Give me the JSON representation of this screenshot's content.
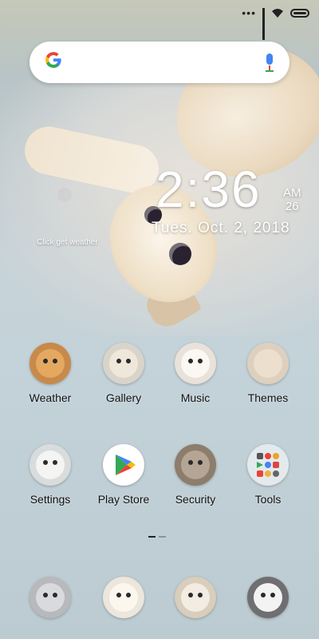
{
  "status_bar": {
    "icons": [
      "dots-icon",
      "signal-icon",
      "wifi-icon",
      "battery-icon"
    ],
    "dots": "•••"
  },
  "search": {
    "logo": "G",
    "mic_icon": "mic-icon"
  },
  "clock": {
    "time": "2:36",
    "ampm": "AM",
    "day_number": "26",
    "date": "Tues.  Oct. 2,  2018"
  },
  "weather": {
    "link": "Click get weather"
  },
  "apps": [
    {
      "label": "Weather",
      "icon": "weather-cat-icon"
    },
    {
      "label": "Gallery",
      "icon": "gallery-cat-icon"
    },
    {
      "label": "Music",
      "icon": "music-cat-icon"
    },
    {
      "label": "Themes",
      "icon": "themes-cat-icon"
    },
    {
      "label": "Settings",
      "icon": "settings-cat-icon"
    },
    {
      "label": "Play Store",
      "icon": "play-store-icon"
    },
    {
      "label": "Security",
      "icon": "security-cat-icon"
    },
    {
      "label": "Tools",
      "icon": "tools-folder-icon"
    }
  ],
  "dock": [
    {
      "icon": "dock-app-1-cat-icon"
    },
    {
      "icon": "dock-app-2-cat-icon"
    },
    {
      "icon": "dock-app-3-cat-icon"
    },
    {
      "icon": "dock-app-4-cat-icon"
    }
  ],
  "pager": {
    "pages": 2,
    "current": 1
  },
  "colors": {
    "google_blue": "#4285F4",
    "google_red": "#EA4335",
    "google_yellow": "#FBBC05",
    "google_green": "#34A853"
  }
}
